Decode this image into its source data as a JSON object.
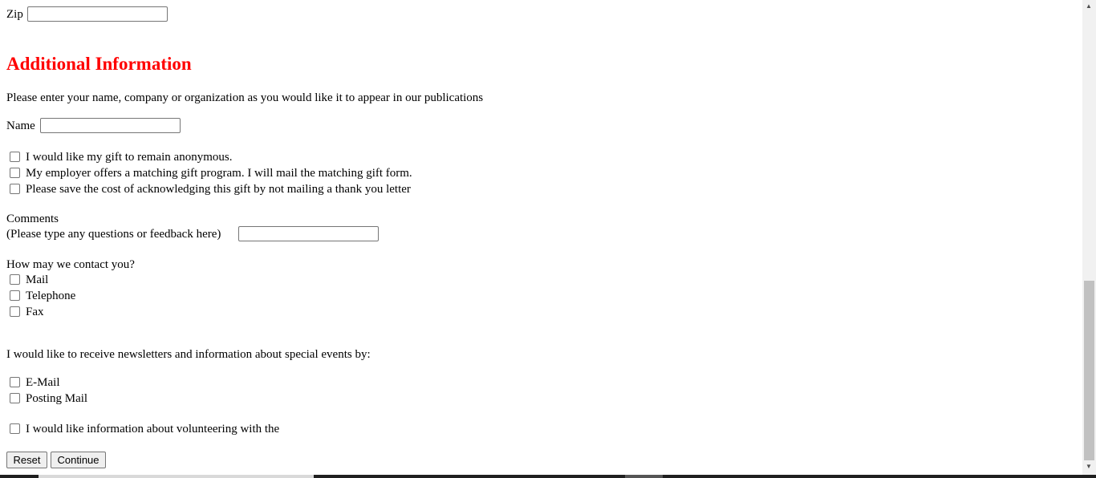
{
  "form": {
    "zip_label": "Zip",
    "zip_value": "",
    "heading": "Additional Information",
    "heading_color": "#ff0000",
    "intro": "Please enter your name, company or organization as you would like it to appear in our publications",
    "name_label": "Name",
    "name_value": "",
    "options": [
      {
        "label": "I would like my gift to remain anonymous.",
        "checked": false
      },
      {
        "label": "My employer offers a matching gift program. I will mail the matching gift form.",
        "checked": false
      },
      {
        "label": "Please save the cost of acknowledging this gift by not mailing a thank you letter",
        "checked": false
      }
    ],
    "comments_label": "Comments",
    "comments_hint": "(Please type any questions or feedback here)",
    "comments_value": "",
    "contact_question": "How may we contact you?",
    "contact_methods": [
      {
        "label": "Mail",
        "checked": false
      },
      {
        "label": "Telephone",
        "checked": false
      },
      {
        "label": "Fax",
        "checked": false
      }
    ],
    "newsletter_question": "I would like to receive newsletters and information about special events by:",
    "newsletter_methods": [
      {
        "label": "E-Mail",
        "checked": false
      },
      {
        "label": "Posting Mail",
        "checked": false
      }
    ],
    "volunteer_label": "I would like information about volunteering with the",
    "reset_label": "Reset",
    "continue_label": "Continue"
  }
}
